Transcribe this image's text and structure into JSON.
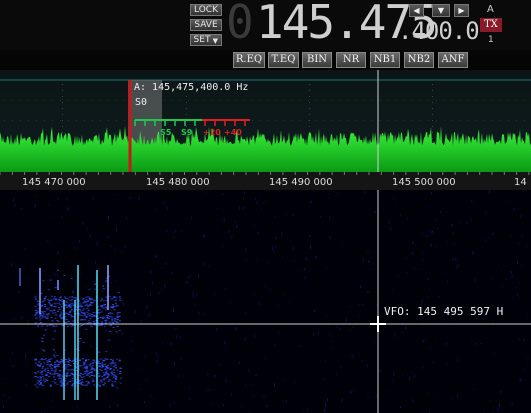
{
  "controls": {
    "lock_label": "LOCK",
    "save_label": "SAVE",
    "set_label": "SET",
    "set_arrow": "▼"
  },
  "frequency": {
    "vfo_digit": "0",
    "main": "145.475",
    "sub": ".400.0"
  },
  "nav": {
    "left": "◀",
    "down": "▼",
    "right": "▶"
  },
  "vfo_side": {
    "a_label": "A",
    "tx_label": "TX",
    "number": "1"
  },
  "dsp_buttons": [
    "R.EQ",
    "T.EQ",
    "BIN",
    "NR",
    "NB1",
    "NB2",
    "ANF"
  ],
  "spectrum": {
    "rx_frequency": "A: 145,475,400.0 Hz",
    "s_reading": "S0",
    "meter_labels": [
      "S5",
      "S9",
      "+20",
      "+40"
    ],
    "colors": {
      "trace": "#22e62a",
      "filter_marker": "#c81818",
      "meter_green": "#1ec850",
      "meter_red": "#e02020"
    }
  },
  "scale": {
    "ticks": [
      "145 470 000",
      "145 480 000",
      "145 490 000",
      "145 500 000",
      "14"
    ]
  },
  "waterfall": {
    "vfo_readout": "VFO: 145 495 597 H",
    "signal_color": "#2a4cff"
  }
}
